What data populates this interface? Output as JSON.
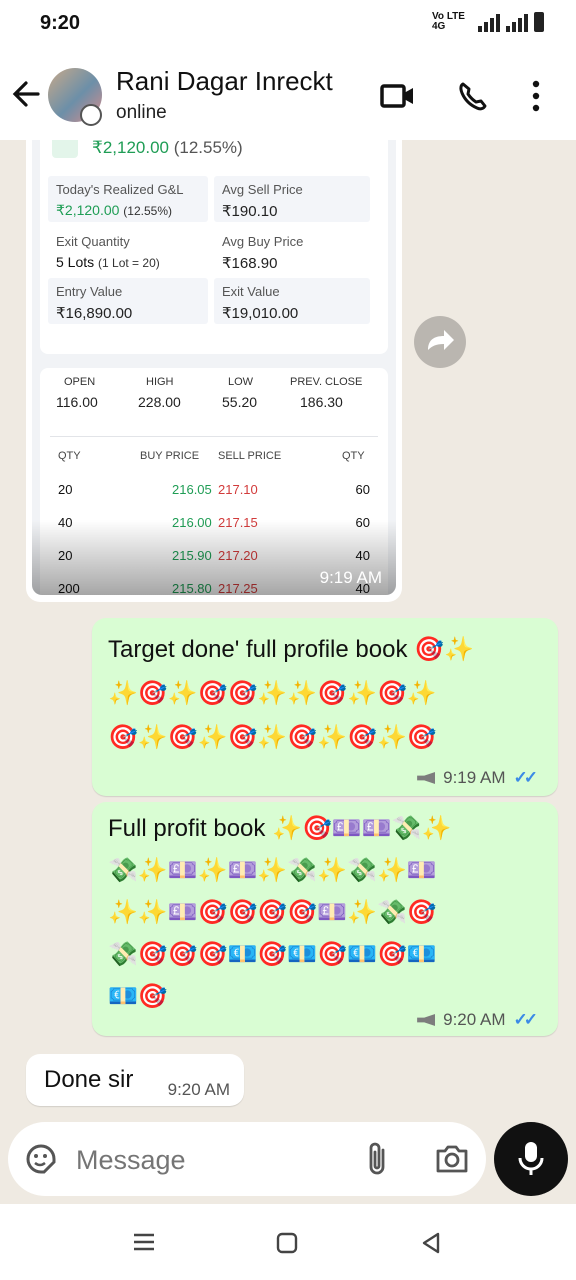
{
  "status_bar": {
    "time": "9:20",
    "network_label": "Vo LTE 4G"
  },
  "header": {
    "contact_name": "Rani Dagar Inreckt",
    "presence": "online"
  },
  "trade_card": {
    "pnl_value": "₹2,120.00",
    "pnl_percent": "(12.55%)",
    "stats": [
      {
        "label": "Today's Realized G&L",
        "value": "₹2,120.00",
        "value_suffix": "(12.55%)"
      },
      {
        "label": "Avg Sell Price",
        "value": "₹190.10"
      },
      {
        "label": "Exit Quantity",
        "value": "5 Lots",
        "value_suffix": "(1 Lot = 20)"
      },
      {
        "label": "Avg Buy Price",
        "value": "₹168.90"
      },
      {
        "label": "Entry Value",
        "value": "₹16,890.00"
      },
      {
        "label": "Exit Value",
        "value": "₹19,010.00"
      }
    ],
    "ohlc_headers": [
      "OPEN",
      "HIGH",
      "LOW",
      "PREV. CLOSE"
    ],
    "ohlc_values": [
      "116.00",
      "228.00",
      "55.20",
      "186.30"
    ],
    "depth_headers": [
      "QTY",
      "BUY PRICE",
      "SELL PRICE",
      "QTY"
    ],
    "depth_rows": [
      [
        "20",
        "216.05",
        "217.10",
        "60"
      ],
      [
        "40",
        "216.00",
        "217.15",
        "60"
      ],
      [
        "20",
        "215.90",
        "217.20",
        "40"
      ],
      [
        "200",
        "215.80",
        "217.25",
        "40"
      ]
    ],
    "timestamp": "9:19 AM"
  },
  "messages": [
    {
      "direction": "outgoing",
      "lines": [
        "Target done' full profile book 🎯✨",
        "✨🎯✨🎯🎯✨✨🎯✨🎯✨",
        "🎯✨🎯✨🎯✨🎯✨🎯✨🎯"
      ],
      "time": "9:19 AM",
      "status": "read"
    },
    {
      "direction": "outgoing",
      "lines": [
        "Full profit book ✨🎯💷💷💸✨",
        "💸✨💷✨💷✨💸✨💸✨💷",
        "✨✨💷🎯🎯🎯🎯💷✨💸🎯",
        "💸🎯🎯🎯💶🎯💶🎯💶🎯💶",
        "💶🎯"
      ],
      "time": "9:20 AM",
      "status": "read"
    },
    {
      "direction": "incoming",
      "text": "Done sir",
      "time": "9:20 AM"
    }
  ],
  "composer": {
    "placeholder": "Message"
  },
  "icons": [
    "back-arrow-icon",
    "video-call-icon",
    "voice-call-icon",
    "more-options-icon",
    "forward-icon",
    "mic-icon",
    "attach-icon",
    "camera-icon",
    "sticker-icon"
  ]
}
